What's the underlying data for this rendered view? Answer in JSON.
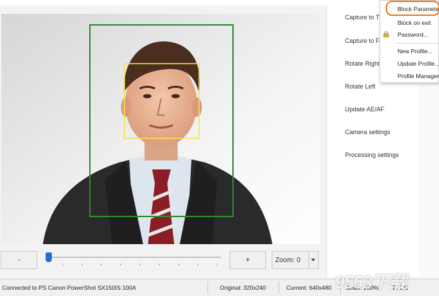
{
  "panel": {
    "items": [
      {
        "label": "Capture to T"
      },
      {
        "label": "Capture to Fi"
      },
      {
        "label": "Rotate Right"
      },
      {
        "label": "Rotate Left"
      },
      {
        "label": "Update AE/AF"
      },
      {
        "label": "Camera settings"
      },
      {
        "label": "Processing settings"
      }
    ]
  },
  "menu": {
    "items": [
      {
        "label": "Block Parameter"
      },
      {
        "label": "Block on exit"
      },
      {
        "label": "Password..."
      },
      {
        "label": "New Profile..."
      },
      {
        "label": "Update Profile..."
      },
      {
        "label": "Profile Manager"
      }
    ]
  },
  "controls": {
    "zoom_out_label": "-",
    "zoom_in_label": "+",
    "zoom_label": "Zoom: 0",
    "slider_position": 0.0
  },
  "status": {
    "connection": "Connected to PS Canon PowerShot SX150IS 100A",
    "original": "Original: 320x240",
    "current": "Current: 640x480",
    "scale": "Scale: 200%",
    "mode": "B: DC"
  },
  "watermark": "9553下载",
  "colors": {
    "face_box": "#2e8b2e",
    "eye_box": "#f2e64a",
    "menu_highlight": "#f07a1a",
    "slider_thumb": "#1f6fd1"
  }
}
